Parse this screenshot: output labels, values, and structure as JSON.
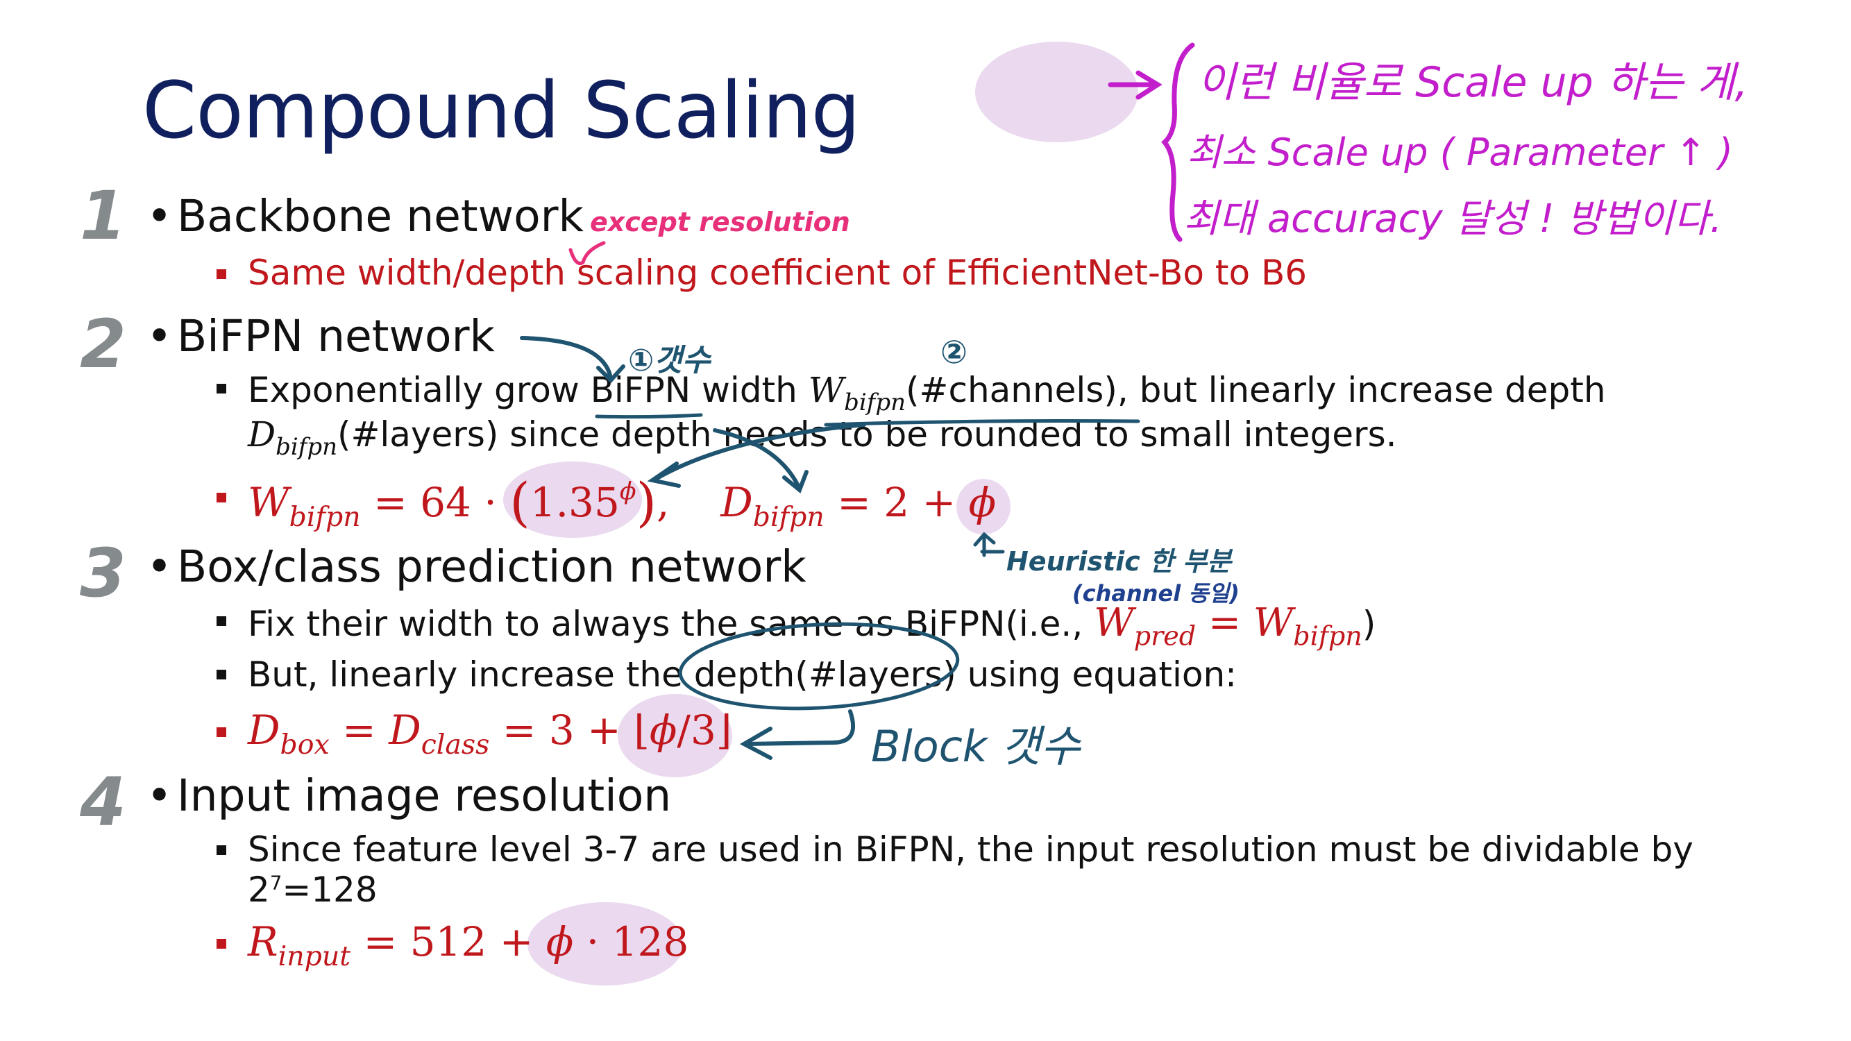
{
  "title": "Compound Scaling",
  "annotation_top": {
    "line1": "이런 비율로 Scale up 하는 게,",
    "line2": "최소 Scale up ( Parameter ↑ )",
    "line3": "최대 accuracy 달성 ! 방법이다."
  },
  "sections": [
    {
      "number": "1",
      "heading": "Backbone network",
      "hand_note": "except resolution",
      "bullet": "Same width/depth scaling coefficient of EfficientNet-Bo to B6"
    },
    {
      "number": "2",
      "heading": "BiFPN network",
      "hand_note_a": "①갯수",
      "hand_note_b": "②",
      "line1_pre": "Exponentially grow BiFPN width ",
      "line1_post": "(#channels), but linearly increase depth",
      "line2_post": "(#layers) since depth needs to be rounded to small integers.",
      "hand_heuristic": "Heuristic 한 부분",
      "hand_channel": "(channel 동일)"
    },
    {
      "number": "3",
      "heading": "Box/class prediction network",
      "bullet1_pre": "Fix their width to always the same as BiFPN(i.e., ",
      "bullet1_post": ")",
      "bullet2": "But, linearly increase the depth(#layers) using equation:",
      "hand_block": "Block 갯수"
    },
    {
      "number": "4",
      "heading": "Input image resolution",
      "bullet1_line1": "Since feature level 3-7 are used in BiFPN, the input resolution must be dividable by",
      "bullet1_line2_base": "2",
      "bullet1_line2_exp": "7",
      "bullet1_line2_rest": "=128"
    }
  ],
  "colors": {
    "title": "#10205e",
    "red": "#c0171c",
    "annotation_magenta": "#c21ecb",
    "annotation_pink": "#e8307a",
    "annotation_blue": "#1f5470",
    "highlight": "#ead9ef",
    "number_gray": "#858a8c"
  }
}
